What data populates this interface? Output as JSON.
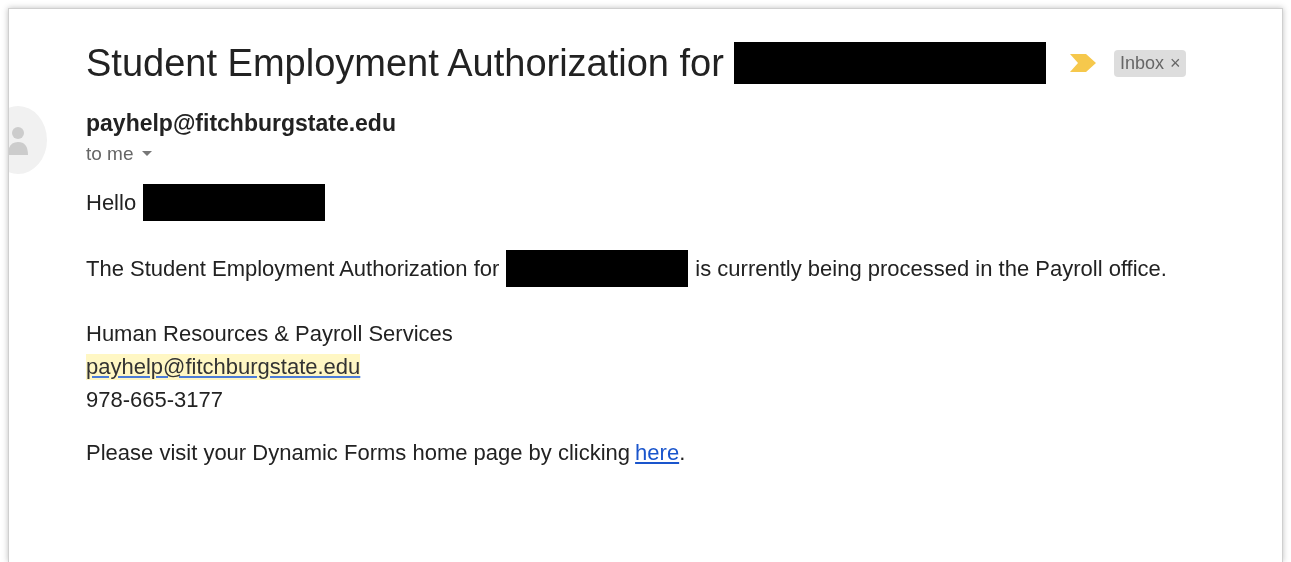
{
  "subject": {
    "segments": [
      {
        "kind": "text",
        "text": "Student Employment Authorization for"
      },
      {
        "kind": "redacted"
      }
    ],
    "important": true,
    "labels": [
      {
        "text": "Inbox",
        "remove": "×"
      }
    ]
  },
  "sender": {
    "email": "payhelp@fitchburgstate.edu",
    "recipient": "to me"
  },
  "body": [
    {
      "segments": [
        {
          "kind": "text",
          "text": "Hello"
        },
        {
          "kind": "redacted"
        }
      ]
    },
    {
      "segments": [
        {
          "kind": "text",
          "text": "The Student Employment Authorization for"
        },
        {
          "kind": "redacted"
        },
        {
          "kind": "text",
          "text": "is currently being processed in the Payroll office."
        }
      ]
    },
    {
      "lines": [
        {
          "kind": "text",
          "text": "Human Resources & Payroll Services"
        },
        {
          "kind": "email",
          "text": "payhelp@fitchburgstate.edu"
        },
        {
          "kind": "text",
          "text": "978-665-3177"
        }
      ]
    },
    {
      "segments": [
        {
          "kind": "text",
          "text": "Please visit your Dynamic Forms home page by clicking"
        },
        {
          "kind": "link",
          "text": "here"
        },
        {
          "kind": "text",
          "text": "."
        }
      ]
    }
  ]
}
